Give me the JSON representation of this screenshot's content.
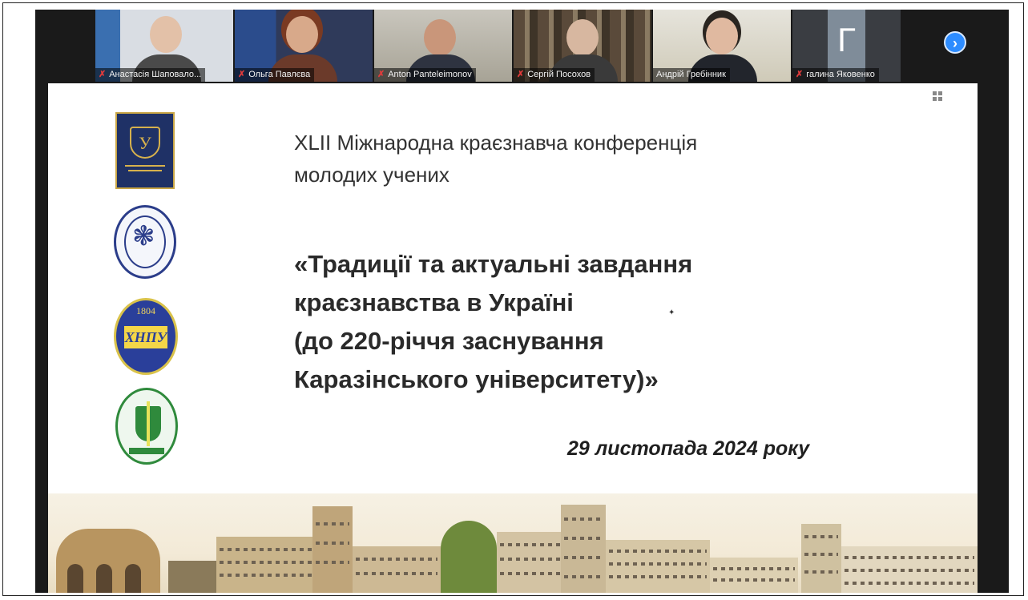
{
  "participants": [
    {
      "name": "Анастасія Шаповало...",
      "muted": true
    },
    {
      "name": "Ольга Павлєва",
      "muted": true
    },
    {
      "name": "Anton Panteleimonov",
      "muted": true
    },
    {
      "name": "Сергій Посохов",
      "muted": true
    },
    {
      "name": "Андрій Гребінник",
      "muted": false,
      "active": true
    },
    {
      "name": "галина Яковенко",
      "muted": true,
      "avatar_letter": "Г"
    }
  ],
  "next_page_icon": "chevron-right-icon",
  "slide": {
    "conference_title": "XLII Міжнародна краєзнавча конференція\nмолодих учених",
    "theme": "«Традиції та актуальні завдання\nкраєзнавства в Україні\n(до 220-річчя заснування\nКаразінського університету)»",
    "date": "29 листопада 2024 року",
    "logo_knpu_year": "1804",
    "logo_knpu_mark": "ХНПУ",
    "logo_univ_mark": "У"
  },
  "colors": {
    "active_speaker": "#c8e06a",
    "mic_muted": "#e23b3b",
    "nav_button": "#2d8cff"
  }
}
